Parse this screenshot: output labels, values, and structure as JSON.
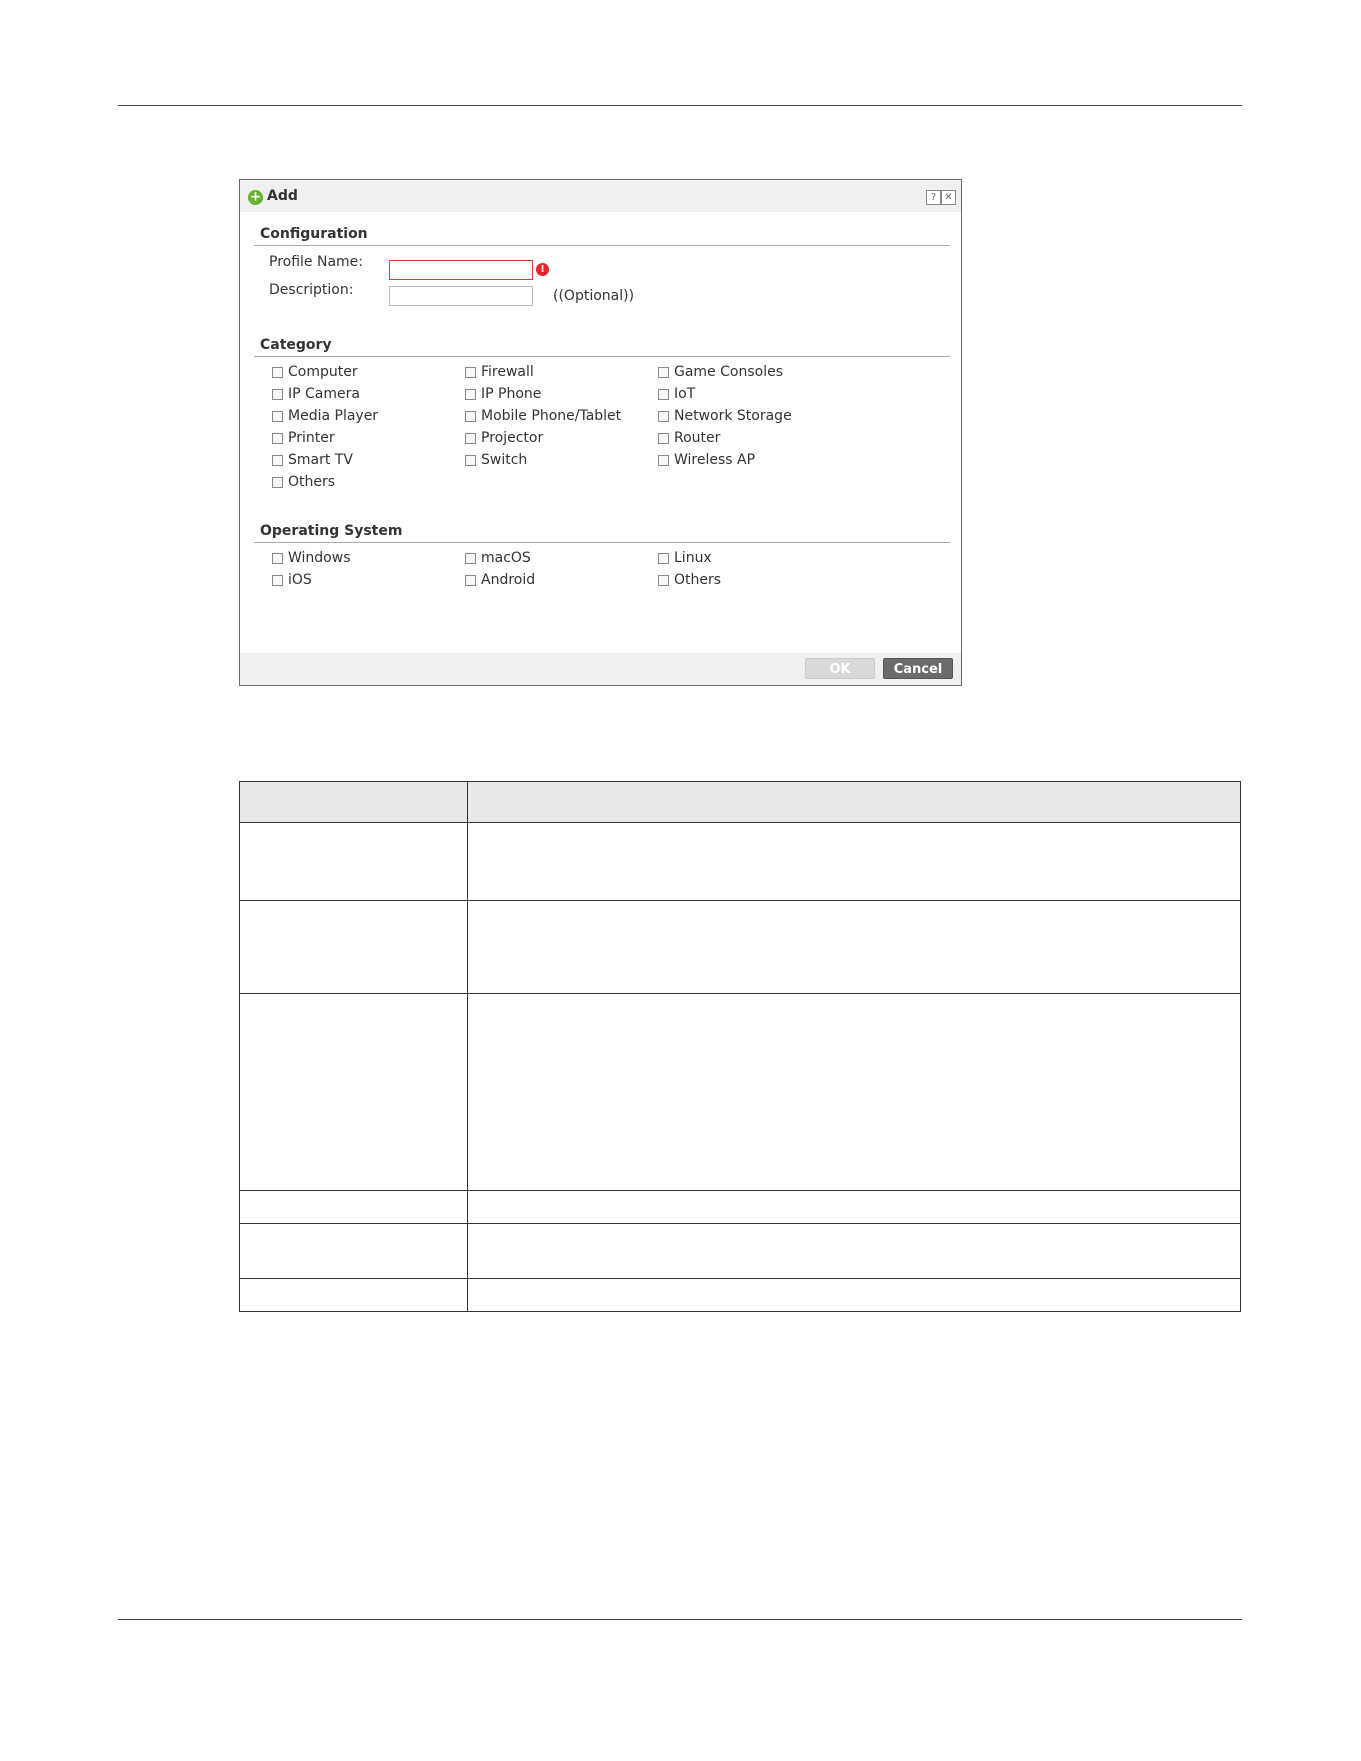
{
  "dialog": {
    "title": "Add",
    "help_glyph": "?",
    "close_glyph": "✕",
    "sections": {
      "configuration": "Configuration",
      "category": "Category",
      "operating_system": "Operating System"
    },
    "fields": {
      "profile_name_label": "Profile Name:",
      "profile_name_value": "",
      "description_label": "Description:",
      "description_value": "",
      "optional_hint": "((Optional))"
    },
    "categories": [
      "Computer",
      "Firewall",
      "Game Consoles",
      "IP Camera",
      "IP Phone",
      "IoT",
      "Media Player",
      "Mobile Phone/Tablet",
      "Network Storage",
      "Printer",
      "Projector",
      "Router",
      "Smart TV",
      "Switch",
      "Wireless AP",
      "Others"
    ],
    "operating_systems": [
      "Windows",
      "macOS",
      "Linux",
      "iOS",
      "Android",
      "Others"
    ],
    "ok_label": "OK",
    "cancel_label": "Cancel"
  },
  "colors": {
    "add_icon": "#62b32f",
    "error": "#e8232e",
    "cancel_button": "#6b6b6b",
    "ok_button_disabled": "#d9d9d9"
  }
}
